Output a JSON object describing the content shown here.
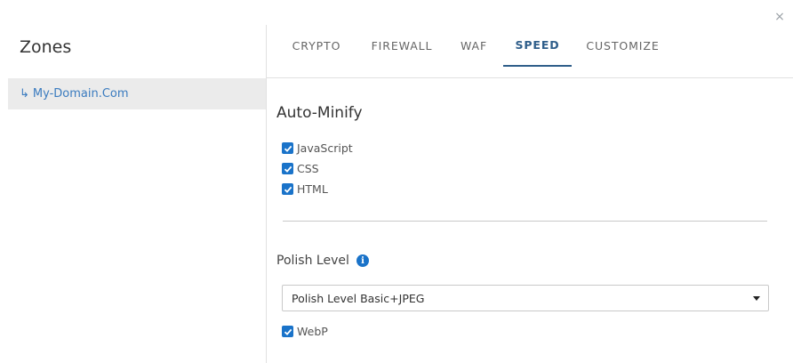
{
  "dialog": {
    "close_label": "×"
  },
  "sidebar": {
    "title": "Zones",
    "zones": [
      {
        "arrow": "↳",
        "label": "My-Domain.Com"
      }
    ]
  },
  "tabs": [
    {
      "label": "CRYPTO",
      "active": false
    },
    {
      "label": "FIREWALL",
      "active": false
    },
    {
      "label": "WAF",
      "active": false
    },
    {
      "label": "SPEED",
      "active": true
    },
    {
      "label": "CUSTOMIZE",
      "active": false
    }
  ],
  "auto_minify": {
    "title": "Auto-Minify",
    "options": [
      {
        "label": "JavaScript",
        "checked": true
      },
      {
        "label": "CSS",
        "checked": true
      },
      {
        "label": "HTML",
        "checked": true
      }
    ]
  },
  "polish": {
    "title": "Polish Level",
    "info_icon": "info-icon",
    "select_value": "Polish Level Basic+JPEG",
    "webp": {
      "label": "WebP",
      "checked": true
    }
  },
  "colors": {
    "accent": "#1a73c9",
    "active_tab": "#2f5e8a",
    "link": "#3a7bbf",
    "sidebar_selected_bg": "#ebebeb"
  }
}
